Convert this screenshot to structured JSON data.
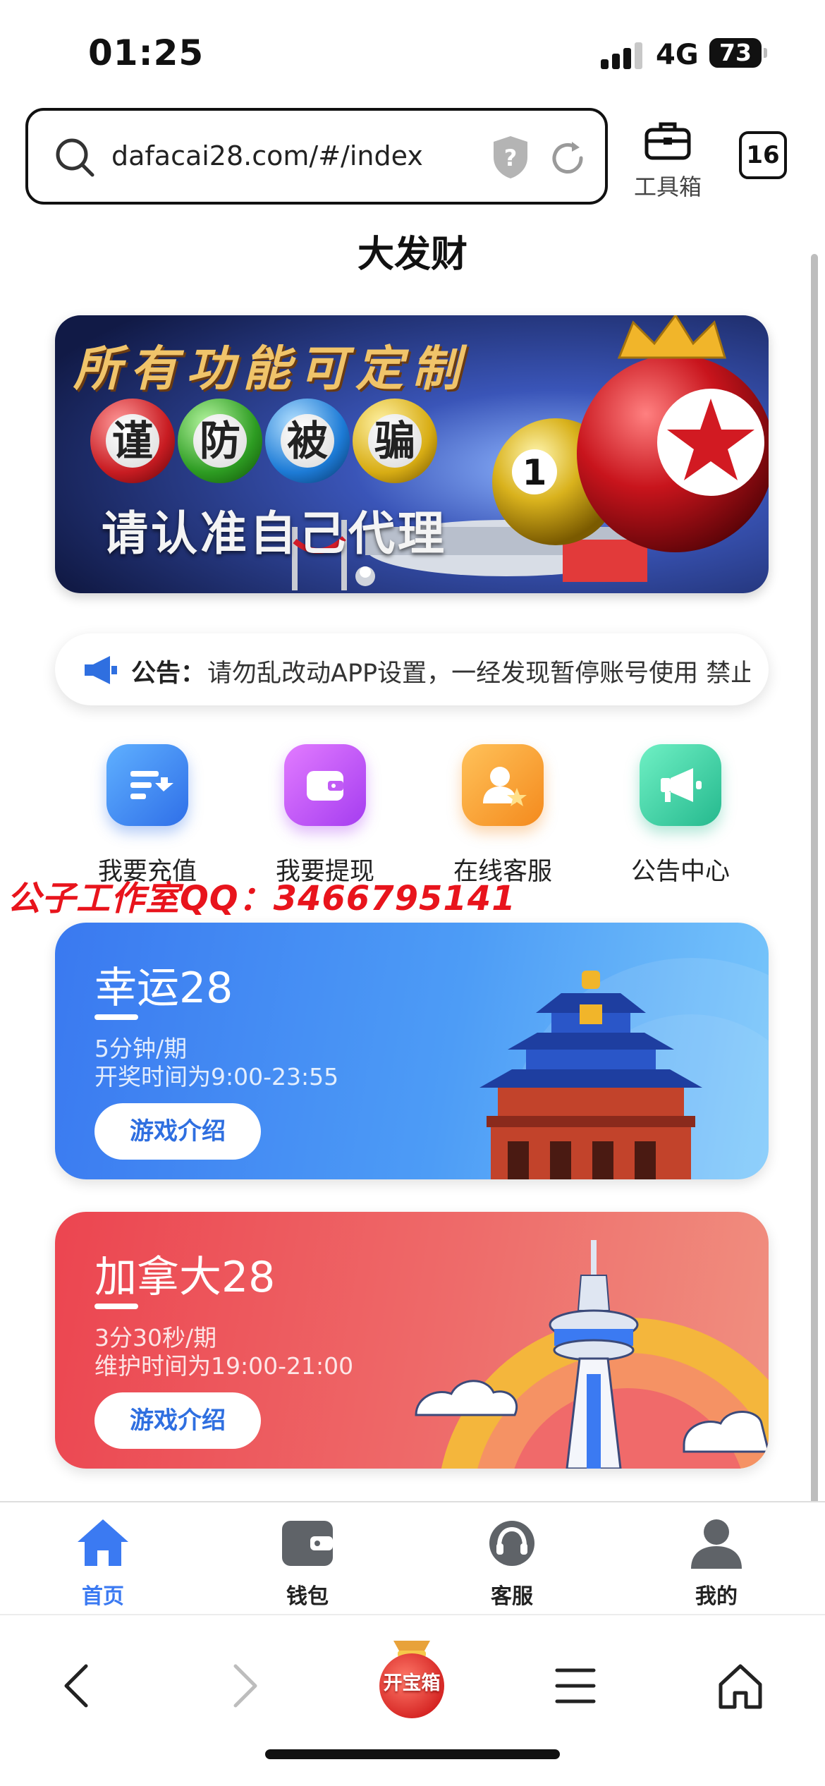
{
  "status_bar": {
    "time": "01:25",
    "network": "4G",
    "battery": "73"
  },
  "browser": {
    "url": "dafacai28.com/#/index",
    "toolbox_label": "工具箱",
    "tab_count": "16"
  },
  "page": {
    "title": "大发财",
    "banner": {
      "headline": "所有功能可定制",
      "warning_chars": [
        "谨",
        "防",
        "被",
        "骗"
      ],
      "subline": "请认准自己代理"
    },
    "notice": {
      "label": "公告：",
      "text": "请勿乱改动APP设置，一经发现暂停账号使用  禁止"
    },
    "quick_actions": [
      {
        "label": "我要充值",
        "icon": "recharge-icon",
        "color": "#3d8df5"
      },
      {
        "label": "我要提现",
        "icon": "wallet-withdraw-icon",
        "color": "#b94ef0"
      },
      {
        "label": "在线客服",
        "icon": "customer-service-icon",
        "color": "#f7a12f"
      },
      {
        "label": "公告中心",
        "icon": "megaphone-icon",
        "color": "#3fd0a8"
      }
    ],
    "watermark": "公子工作室QQ：3466795141",
    "games": [
      {
        "name": "幸运28",
        "period": "5分钟/期",
        "hours": "开奖时间为9:00-23:55",
        "button": "游戏介绍",
        "color": "#3a79f0"
      },
      {
        "name": "加拿大28",
        "period": "3分30秒/期",
        "hours": "维护时间为19:00-21:00",
        "button": "游戏介绍",
        "color": "#ec4550"
      }
    ]
  },
  "app_tabbar": {
    "tabs": [
      {
        "label": "首页",
        "icon": "home-icon",
        "active": true
      },
      {
        "label": "钱包",
        "icon": "wallet-icon",
        "active": false
      },
      {
        "label": "客服",
        "icon": "headset-icon",
        "active": false
      },
      {
        "label": "我的",
        "icon": "user-icon",
        "active": false
      }
    ]
  },
  "browser_bottom": {
    "treasure_label": "开宝箱"
  },
  "colors": {
    "accent": "#3b7af2",
    "watermark": "#e8141c"
  }
}
